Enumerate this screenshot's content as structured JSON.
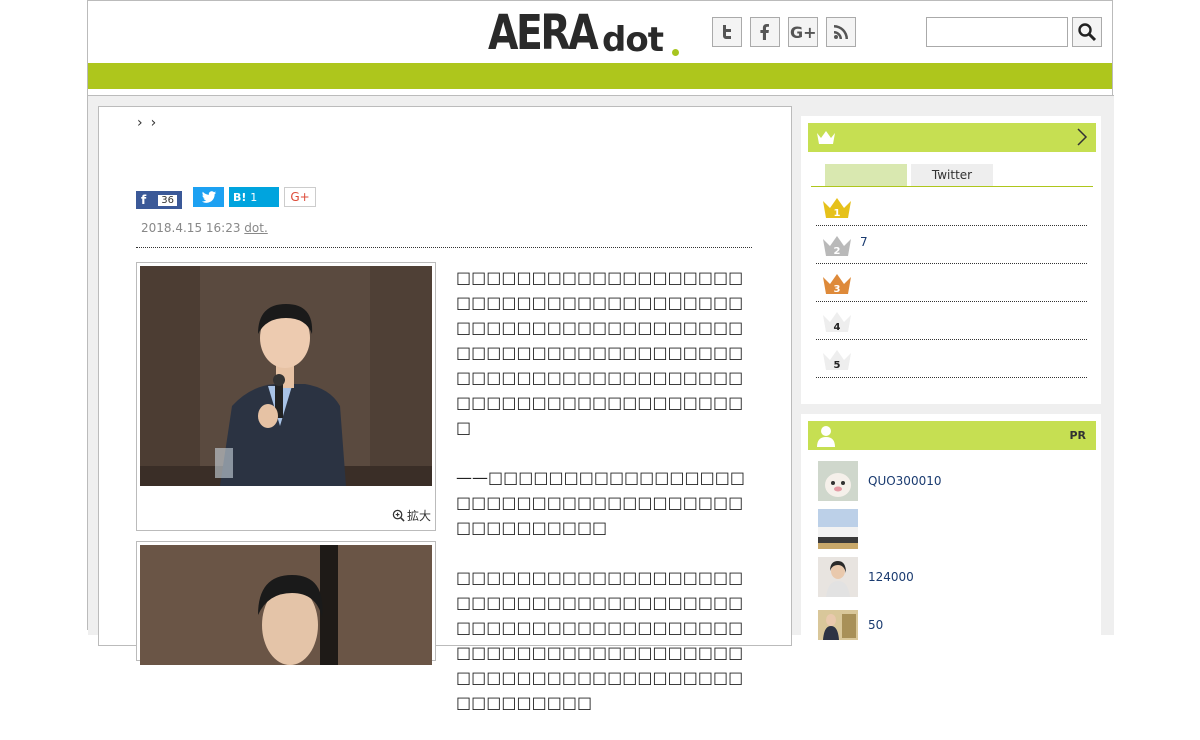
{
  "header": {
    "logo_main": "AERA",
    "logo_sub": "dot",
    "social": [
      {
        "name": "twitter-icon",
        "glyph": "t"
      },
      {
        "name": "facebook-icon",
        "glyph": "f"
      },
      {
        "name": "google-plus-icon",
        "glyph": "G+"
      },
      {
        "name": "rss-icon",
        "glyph": "rss"
      }
    ],
    "search_placeholder": ""
  },
  "colors": {
    "brand_green": "#aec61c",
    "panel_green": "#c6df52",
    "link_blue": "#1a3b70"
  },
  "breadcrumb": [
    "",
    ""
  ],
  "share": {
    "facebook_count": "36",
    "hatena_label": "B!",
    "hatena_count": "1",
    "google_label": "G+"
  },
  "article": {
    "date": "2018.4.15 16:23",
    "source": "dot.",
    "zoom_label": "拡大",
    "paragraphs": [
      "□□□□□□□□□□□□□□□□□□□□□□□□□□□□□□□□□□□□□□□□□□□□□□□□□□□□□□□□□□□□□□□□□□□□□□□□□□□□□□□□□□□□□□□□□□□□□□□□□□□□□□□□□□□□□□□□□□□",
      "——□□□□□□□□□□□□□□□□□□□□□□□□□□□□□□□□□□□□□□□□□□□□□□",
      "□□□□□□□□□□□□□□□□□□□□□□□□□□□□□□□□□□□□□□□□□□□□□□□□□□□□□□□□□□□□□□□□□□□□□□□□□□□□□□□□□□□□□□□□□□□□□□□□□□□□□□□□"
    ]
  },
  "ranking": {
    "tabs": [
      "",
      "Twitter"
    ],
    "items": [
      {
        "rank": "1",
        "text": ""
      },
      {
        "rank": "2",
        "text": "7"
      },
      {
        "rank": "3",
        "text": ""
      },
      {
        "rank": "4",
        "text": ""
      },
      {
        "rank": "5",
        "text": ""
      }
    ]
  },
  "pr": {
    "label": "PR",
    "items": [
      {
        "text": "QUO300010"
      },
      {
        "text": ""
      },
      {
        "text": "124000"
      },
      {
        "text": "50"
      }
    ]
  }
}
